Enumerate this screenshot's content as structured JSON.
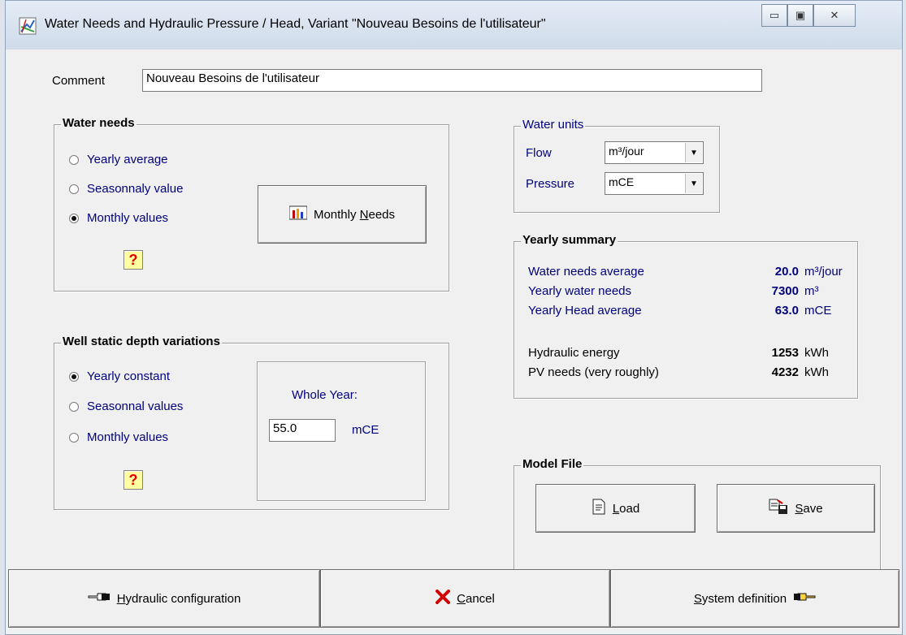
{
  "window": {
    "title": "Water Needs and Hydraulic Pressure / Head, Variant  \"Nouveau Besoins de l'utilisateur\"",
    "minimize_glyph": "▭",
    "maximize_glyph": "▣",
    "close_glyph": "✕"
  },
  "comment": {
    "label": "Comment",
    "value": "Nouveau Besoins de l'utilisateur"
  },
  "water_needs": {
    "title": "Water needs",
    "options": [
      {
        "label": "Yearly average",
        "selected": false
      },
      {
        "label": "Seasonnaly value",
        "selected": false
      },
      {
        "label": "Monthly values",
        "selected": true
      }
    ],
    "monthly_button": {
      "pre": "Monthly ",
      "underlined": "N",
      "post": "eeds"
    },
    "help": "?"
  },
  "water_units": {
    "title": "Water units",
    "flow_label": "Flow",
    "flow_value": "m³/jour",
    "pressure_label": "Pressure",
    "pressure_value": "mCE"
  },
  "yearly_summary": {
    "title": "Yearly summary",
    "rows": [
      {
        "label": "Water needs average",
        "value": "20.0",
        "unit": "m³/jour"
      },
      {
        "label": "Yearly water needs",
        "value": "7300",
        "unit": "m³"
      },
      {
        "label": "Yearly Head average",
        "value": "63.0",
        "unit": "mCE"
      },
      {
        "label": "Hydraulic energy",
        "value": "1253",
        "unit": "kWh"
      },
      {
        "label": "PV needs (very roughly)",
        "value": "4232",
        "unit": "kWh"
      }
    ]
  },
  "well_depth": {
    "title": "Well static depth variations",
    "options": [
      {
        "label": "Yearly constant",
        "selected": true
      },
      {
        "label": "Seasonnal values",
        "selected": false
      },
      {
        "label": "Monthly values",
        "selected": false
      }
    ],
    "whole_year_label": "Whole Year:",
    "depth_value": "55.0",
    "depth_unit": "mCE",
    "help": "?"
  },
  "model_file": {
    "title": "Model File",
    "load": {
      "underlined": "L",
      "post": "oad"
    },
    "save": {
      "underlined": "S",
      "post": "ave"
    }
  },
  "bottom": {
    "hydraulic": {
      "underlined": "H",
      "post": "ydraulic configuration"
    },
    "cancel": {
      "underlined": "C",
      "post": "ancel"
    },
    "system": {
      "underlined": "S",
      "post": "ystem definition"
    }
  },
  "colors": {
    "label_blue": "#00007f",
    "help_bg": "#ffffa0",
    "cancel_x": "#d00000"
  }
}
